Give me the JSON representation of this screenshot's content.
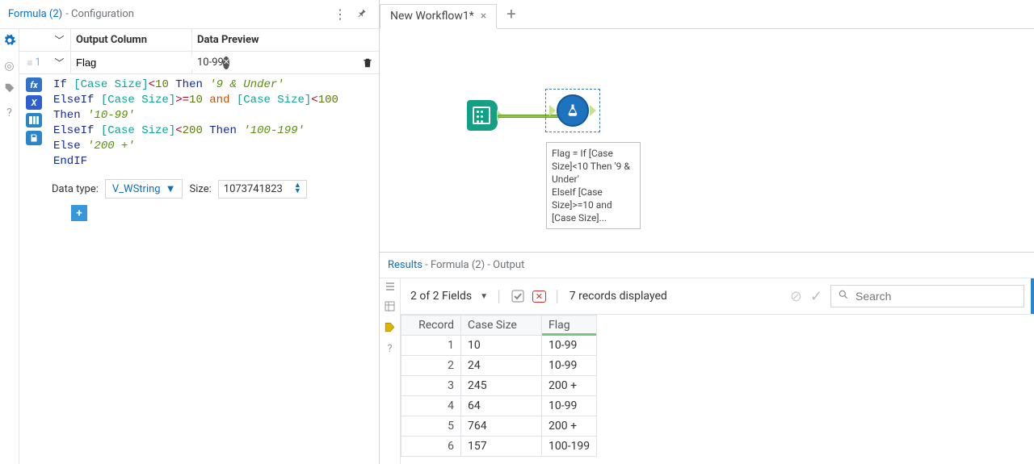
{
  "config_panel": {
    "title_main": "Formula (2)",
    "title_sub": " - Configuration",
    "columns_header": {
      "output": "Output Column",
      "preview": "Data Preview"
    },
    "row_number": "1",
    "output_column_value": "Flag",
    "data_preview_value": "10-99",
    "formula_lines": [
      [
        {
          "t": "If ",
          "c": "kw"
        },
        {
          "t": "[Case Size]",
          "c": "col"
        },
        {
          "t": "<",
          "c": "op"
        },
        {
          "t": "10",
          "c": "num"
        },
        {
          "t": " Then ",
          "c": "kw"
        },
        {
          "t": "'9 & Under'",
          "c": "str"
        }
      ],
      [
        {
          "t": "ElseIf ",
          "c": "kw"
        },
        {
          "t": "[Case Size]",
          "c": "col"
        },
        {
          "t": ">=",
          "c": "op"
        },
        {
          "t": "10",
          "c": "num"
        },
        {
          "t": " and ",
          "c": "and"
        },
        {
          "t": "[Case Size]",
          "c": "col"
        },
        {
          "t": "<",
          "c": "op"
        },
        {
          "t": "100",
          "c": "num"
        }
      ],
      [
        {
          "t": "Then ",
          "c": "kw"
        },
        {
          "t": "'10-99'",
          "c": "str"
        }
      ],
      [
        {
          "t": "ElseIf ",
          "c": "kw"
        },
        {
          "t": "[Case Size]",
          "c": "col"
        },
        {
          "t": "<",
          "c": "op"
        },
        {
          "t": "200",
          "c": "num"
        },
        {
          "t": " Then ",
          "c": "kw"
        },
        {
          "t": "'100-199'",
          "c": "str"
        }
      ],
      [
        {
          "t": "Else ",
          "c": "kw"
        },
        {
          "t": "'200 +'",
          "c": "str"
        }
      ],
      [
        {
          "t": "EndIF",
          "c": "endif"
        }
      ]
    ],
    "datatype_label": "Data type:",
    "datatype_value": "V_WString",
    "size_label": "Size:",
    "size_value": "1073741823"
  },
  "workflow": {
    "tab_label": "New Workflow1*",
    "tool_annotation": "Flag = If [Case Size]<10 Then '9 & Under'\nElseIf [Case Size]>=10 and [Case Size]..."
  },
  "results": {
    "title_main": "Results",
    "title_sub": " - Formula (2) - Output",
    "fields_summary": "2 of 2 Fields",
    "records_summary": "7 records displayed",
    "search_placeholder": "Search",
    "columns": [
      "Record",
      "Case Size",
      "Flag"
    ],
    "rows": [
      {
        "record": "1",
        "case_size": "10",
        "flag": "10-99"
      },
      {
        "record": "2",
        "case_size": "24",
        "flag": "10-99"
      },
      {
        "record": "3",
        "case_size": "245",
        "flag": "200 +"
      },
      {
        "record": "4",
        "case_size": "64",
        "flag": "10-99"
      },
      {
        "record": "5",
        "case_size": "764",
        "flag": "200 +"
      },
      {
        "record": "6",
        "case_size": "157",
        "flag": "100-199"
      }
    ]
  }
}
